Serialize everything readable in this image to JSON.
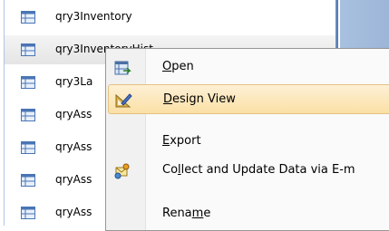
{
  "nav_items": [
    {
      "label": "qry3Inventory"
    },
    {
      "label": "qry3InventoryHist"
    },
    {
      "label": "qry3La"
    },
    {
      "label": "qryAss"
    },
    {
      "label": "qryAss"
    },
    {
      "label": "qryAss"
    },
    {
      "label": "qryAss"
    }
  ],
  "context_menu": {
    "items": [
      {
        "pre": "",
        "accel": "O",
        "post": "pen",
        "icon": "open-icon"
      },
      {
        "pre": "",
        "accel": "D",
        "post": "esign View",
        "icon": "design-view-icon"
      },
      {
        "pre": "",
        "accel": "E",
        "post": "xport",
        "icon": ""
      },
      {
        "pre": "Co",
        "accel": "l",
        "post": "lect and Update Data via E-m",
        "icon": "collect-data-icon"
      },
      {
        "pre": "Rena",
        "accel": "m",
        "post": "e",
        "icon": ""
      }
    ]
  }
}
